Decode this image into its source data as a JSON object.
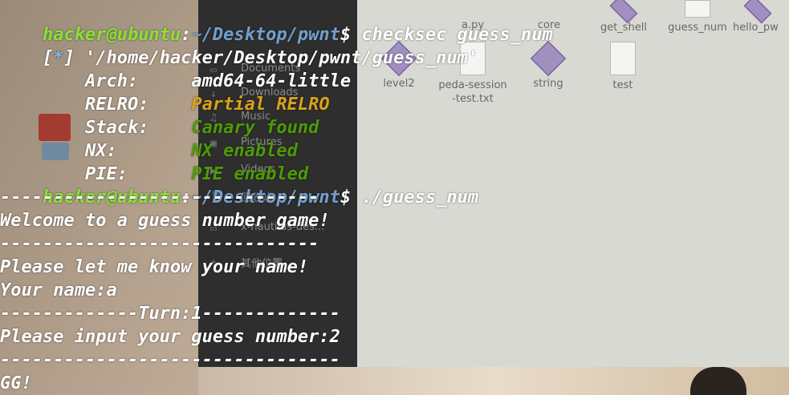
{
  "terminal": {
    "prompt": {
      "user_host": "hacker@ubuntu",
      "colon": ":",
      "path": "~/Desktop/pwnt",
      "dollar": "$"
    },
    "cmd_checksec": " checksec guess_num",
    "checksec_header": {
      "open": "[",
      "star": "*",
      "close": "]",
      "path": " '/home/hacker/Desktop/pwnt/guess_num'"
    },
    "checksec": [
      {
        "key": "    Arch:     ",
        "value": "amd64-64-little",
        "color": "#ffffff"
      },
      {
        "key": "    RELRO:    ",
        "value": "Partial RELRO",
        "color": "#d7a21a"
      },
      {
        "key": "    Stack:    ",
        "value": "Canary found",
        "color": "#4e9a06"
      },
      {
        "key": "    NX:       ",
        "value": "NX enabled",
        "color": "#4e9a06"
      },
      {
        "key": "    PIE:      ",
        "value": "PIE enabled",
        "color": "#4e9a06"
      }
    ],
    "cmd_run": " ./guess_num",
    "output": [
      "------------------------------",
      "Welcome to a guess number game!",
      "------------------------------",
      "Please let me know your name!",
      "Your name:a",
      "-------------Turn:1-------------",
      "Please input your guess number:2",
      "--------------------------------",
      "GG!"
    ]
  },
  "desktop": {
    "files": [
      {
        "label": "a.py",
        "icon": "script-file-icon"
      },
      {
        "label": "core",
        "icon": "file-icon"
      },
      {
        "label": "get_shell",
        "icon": "executable-icon"
      },
      {
        "label": "guess_num",
        "icon": "file-icon"
      },
      {
        "label": "hello_pw",
        "icon": "executable-icon"
      },
      {
        "label": "level2",
        "icon": "executable-icon"
      },
      {
        "label": "peda-session-test.txt",
        "icon": "text-file-icon"
      },
      {
        "label": "string",
        "icon": "executable-icon"
      },
      {
        "label": "test",
        "icon": "text-file-icon"
      }
    ],
    "places": [
      "Documents",
      "Downloads",
      "Music",
      "Pictures",
      "Videos",
      "回收站",
      "x-nautilus-des...",
      "其他位置"
    ]
  }
}
